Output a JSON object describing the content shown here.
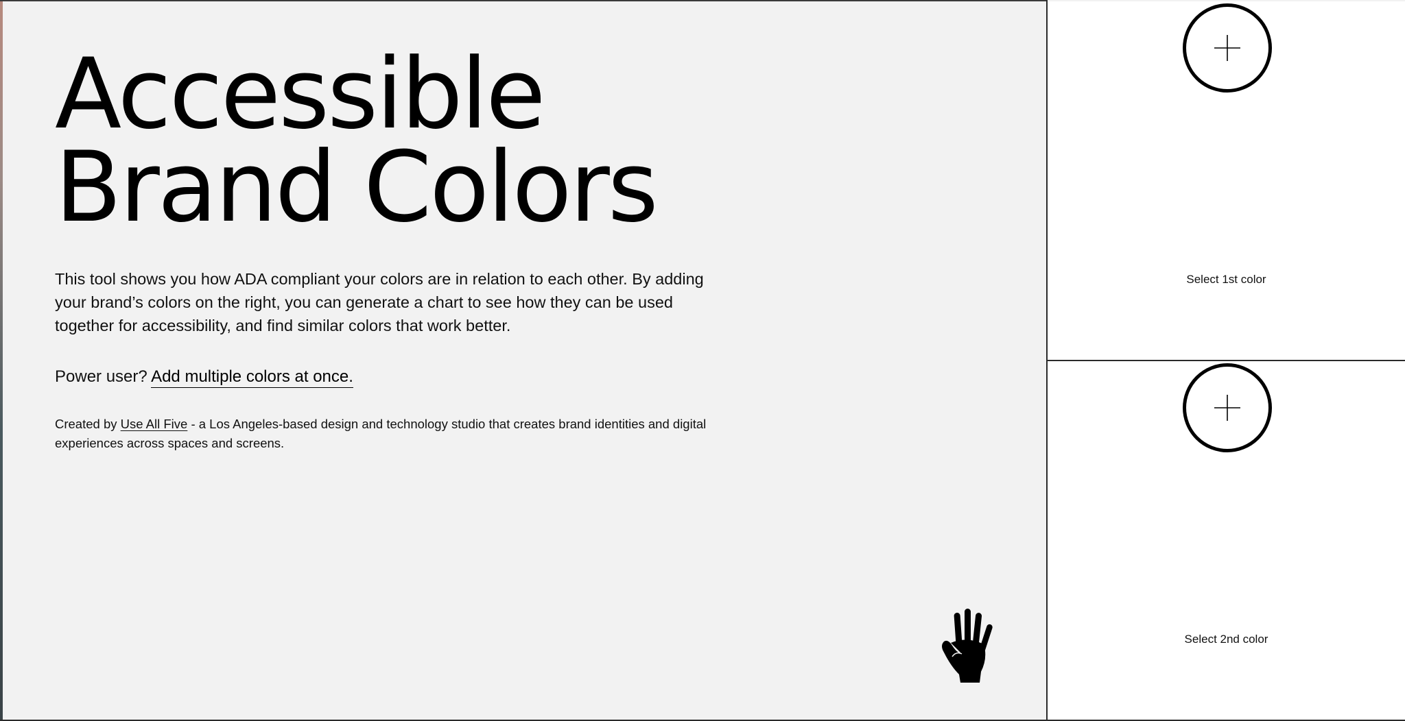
{
  "hero": {
    "title_line_1": "Accessible",
    "title_line_2": "Brand Colors"
  },
  "intro": {
    "text": "This tool shows you how ADA compliant your colors are in relation to each other. By adding your brand’s colors on the right, you can generate a chart to see how they can be used together for accessibility, and find similar colors that work better."
  },
  "power_user": {
    "prompt": "Power user?",
    "link_label": "Add multiple colors at once."
  },
  "credit": {
    "prefix": "Created by",
    "studio_link": "Use All Five",
    "suffix": "- a Los Angeles-based design and technology studio that creates brand identities and digital experiences across spaces and screens."
  },
  "color_pickers": [
    {
      "label": "Select 1st color",
      "icon": "plus-icon"
    },
    {
      "label": "Select 2nd color",
      "icon": "plus-icon"
    }
  ],
  "decor": {
    "hand_icon": "raised-hand-icon"
  },
  "colors": {
    "page_background": "#f2f2f2",
    "swatch_background": "#ffffff",
    "text": "#000000"
  }
}
